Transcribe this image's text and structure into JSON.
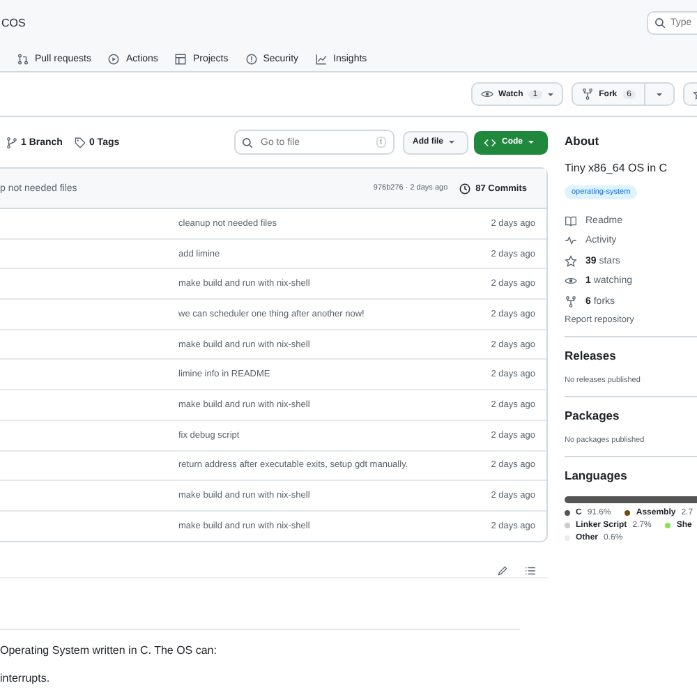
{
  "header": {
    "repo_name": "COS",
    "search": {
      "placeholder": "Type"
    },
    "nav_tabs": [
      {
        "label": "Pull requests"
      },
      {
        "label": "Actions"
      },
      {
        "label": "Projects"
      },
      {
        "label": "Security"
      },
      {
        "label": "Insights"
      }
    ]
  },
  "repo_actions": {
    "watch": {
      "label": "Watch",
      "count": "1"
    },
    "fork": {
      "label": "Fork",
      "count": "6"
    }
  },
  "branch_bar": {
    "branches": "1 Branch",
    "tags": "0 Tags",
    "goto": {
      "placeholder": "Go to file",
      "shortcut": "t"
    },
    "add_file": "Add file",
    "code": "Code"
  },
  "latest_commit": {
    "message": "p not needed files",
    "hash_time": "976b276 · 2 days ago",
    "commits": "87 Commits"
  },
  "files": [
    {
      "message": "cleanup not needed files",
      "time": "2 days ago"
    },
    {
      "message": "add limine",
      "time": "2 days ago"
    },
    {
      "message": "make build and run with nix-shell",
      "time": "2 days ago"
    },
    {
      "message": "we can scheduler one thing after another now!",
      "time": "2 days ago"
    },
    {
      "message": "make build and run with nix-shell",
      "time": "2 days ago"
    },
    {
      "message": "limine info in README",
      "time": "2 days ago"
    },
    {
      "message": "make build and run with nix-shell",
      "time": "2 days ago"
    },
    {
      "message": "fix debug script",
      "time": "2 days ago"
    },
    {
      "message": "return address after executable exits, setup gdt manually.",
      "time": "2 days ago"
    },
    {
      "message": "make build and run with nix-shell",
      "time": "2 days ago"
    },
    {
      "message": "make build and run with nix-shell",
      "time": "2 days ago"
    }
  ],
  "readme": {
    "lines": [
      "Operating System written in C. The OS can:",
      "interrupts."
    ]
  },
  "about": {
    "title": "About",
    "description": "Tiny x86_64 OS in C",
    "topic": "operating-system",
    "stats": [
      {
        "label": "Readme"
      },
      {
        "label": "Activity"
      },
      {
        "label": "**39** stars"
      },
      {
        "label": "**1** watching"
      },
      {
        "label": "**6** forks"
      }
    ],
    "report": "Report repository"
  },
  "releases": {
    "title": "Releases",
    "note": "No releases published"
  },
  "packages": {
    "title": "Packages",
    "note": "No packages published"
  },
  "languages": {
    "title": "Languages",
    "items": [
      {
        "name": "C",
        "percent": "91.6%",
        "color": "#555555"
      },
      {
        "name": "Assembly",
        "percent": "2.7",
        "color": "#6e4c13"
      },
      {
        "name": "Linker Script",
        "percent": "2.7%",
        "color": "#cccccc"
      },
      {
        "name": "She",
        "color": "#89e051"
      },
      {
        "name": "Other",
        "percent": "0.6%",
        "color": "#ededed"
      }
    ]
  }
}
